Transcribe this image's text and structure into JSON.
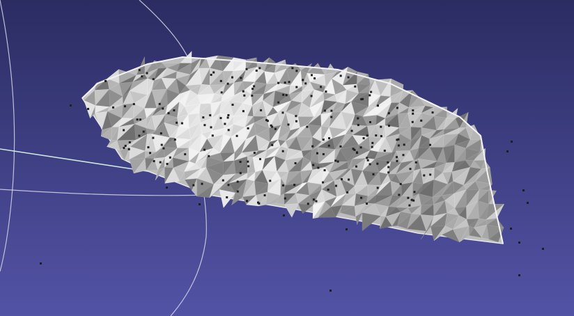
{
  "viewer": {
    "background_top": "#2b2c62",
    "background_bottom": "#5353a6",
    "mesh_base_color": "#c8c8c8",
    "mesh_light_color": "#ececec",
    "mesh_dark_color": "#6e6e6e",
    "point_color": "#1e1e1e",
    "trackball_circle_color": "#d8d8e8",
    "trackball_axis_color": "#d0e8e0",
    "icons": [
      "trackball-gizmo",
      "mesh-model",
      "point-cloud"
    ]
  }
}
